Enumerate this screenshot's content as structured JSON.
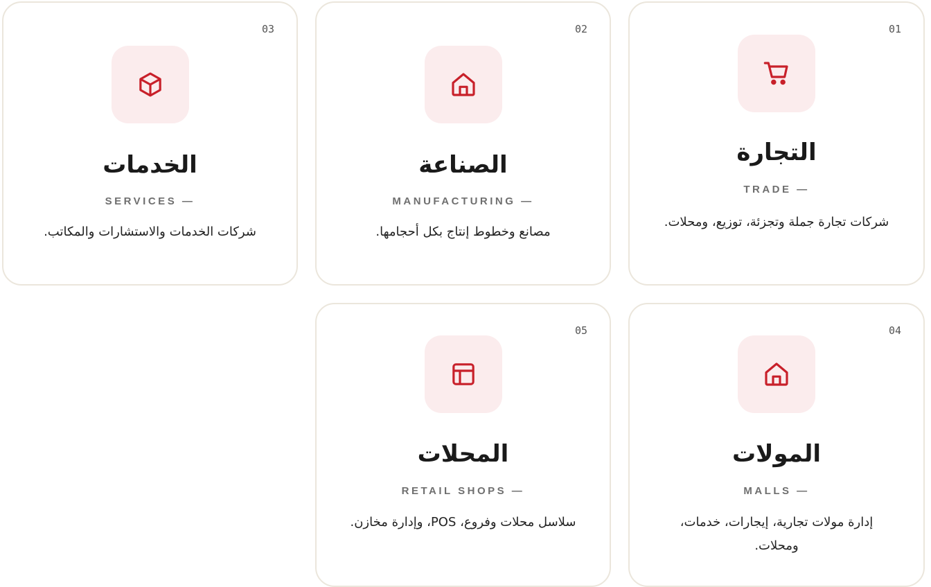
{
  "colors": {
    "accent": "#c8202a",
    "icon_bg": "#fbeced",
    "border": "#ebe6dc"
  },
  "cards": [
    {
      "number": "01",
      "icon": "cart-icon",
      "title": "التجارة",
      "subtitle": "TRADE —",
      "description": "شركات تجارة جملة وتجزئة، توزيع، ومحلات."
    },
    {
      "number": "02",
      "icon": "home-icon",
      "title": "الصناعة",
      "subtitle": "MANUFACTURING —",
      "description": "مصانع وخطوط إنتاج بكل أحجامها."
    },
    {
      "number": "03",
      "icon": "box-icon",
      "title": "الخدمات",
      "subtitle": "SERVICES —",
      "description": "شركات الخدمات والاستشارات والمكاتب."
    },
    {
      "number": "04",
      "icon": "home-icon",
      "title": "المولات",
      "subtitle": "MALLS —",
      "description": "إدارة مولات تجارية، إيجارات، خدمات، ومحلات."
    },
    {
      "number": "05",
      "icon": "layout-icon",
      "title": "المحلات",
      "subtitle": "RETAIL SHOPS —",
      "description": "سلاسل محلات وفروع، POS، وإدارة مخازن."
    }
  ]
}
